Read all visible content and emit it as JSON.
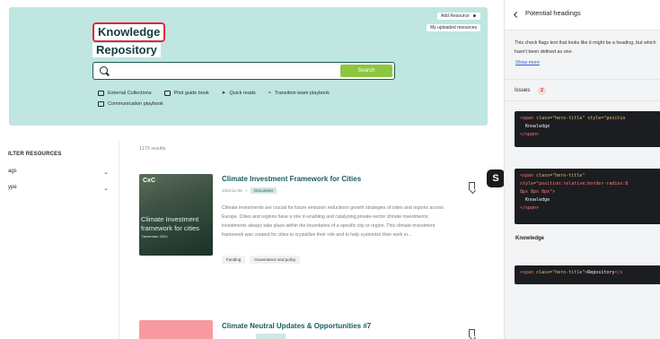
{
  "hero": {
    "title_line1": "Knowledge",
    "title_line2": "Repository",
    "add_resource": "Add Resource",
    "my_uploaded": "My uploaded resources",
    "search_placeholder": "",
    "search_button": "Search",
    "quick_links": [
      {
        "label": "External Collections",
        "icon": "folder-icon"
      },
      {
        "label": "Pilot guide book",
        "icon": "book-icon"
      },
      {
        "label": "Quick reads",
        "icon": "tag-icon"
      },
      {
        "label": "Transition team playbook",
        "icon": "team-icon"
      },
      {
        "label": "Communication playbook",
        "icon": "chat-icon"
      }
    ]
  },
  "filters": {
    "title": "ILTER RESOURCES",
    "items": [
      {
        "label": "ags"
      },
      {
        "label": "ype"
      }
    ]
  },
  "results": {
    "count": "1179 results",
    "cards": [
      {
        "title": "Climate Investment Framework for Cities",
        "date": "2023-11-05",
        "badge": "Document",
        "cover_logo": "CxC",
        "cover_title": "Climate Investment framework for cities",
        "cover_date": "December 2023",
        "description": "Climate investments are crucial for future emission reductions growth strategies of cities and regions across Europe. Cities and regions have a role in enabling and catalysing private-sector climate investments; investments always take place within the boundaries of a specific city or region. This climate investment framework was created for cities to crystallize their role and to help systemize their work in...",
        "tags": [
          "Funding",
          "Governance and policy"
        ]
      },
      {
        "title": "Climate Neutral Updates & Opportunities #7"
      }
    ]
  },
  "extension": {
    "icon": "S"
  },
  "panel": {
    "title": "Potential headings",
    "description": "This check flags text that looks like it might be a heading, but which hasn't been defined as one.",
    "show_more": "Show more",
    "issues_label": "Issues",
    "issues_count": "2",
    "code1": {
      "line1_tag": "<span",
      "line1_attrs": " class=\"hero-title\" style=\"positio",
      "line2": "  Knowledge",
      "line3": "</span>"
    },
    "code2": {
      "line1_tag": "<span",
      "line1_attrs": " class=\"hero-title\"",
      "line2": "style=\"position:relative;border-radius:8",
      "line3": "8px 8px 0px\">",
      "line4": "  Knowledge",
      "line5": "</span>"
    },
    "knowledge_label": "Knowledge",
    "code3": {
      "line1_tag": "<span",
      "line1_attrs": " class=\"hero-title\">",
      "line1_text": "Repository",
      "line1_close": "</s"
    }
  },
  "colors": {
    "hero_bg": "#bfe6e1",
    "search_button": "#8dc63f",
    "title_highlight": "#e0283b",
    "card_title": "#1b5c5c",
    "link": "#2c60d6"
  }
}
